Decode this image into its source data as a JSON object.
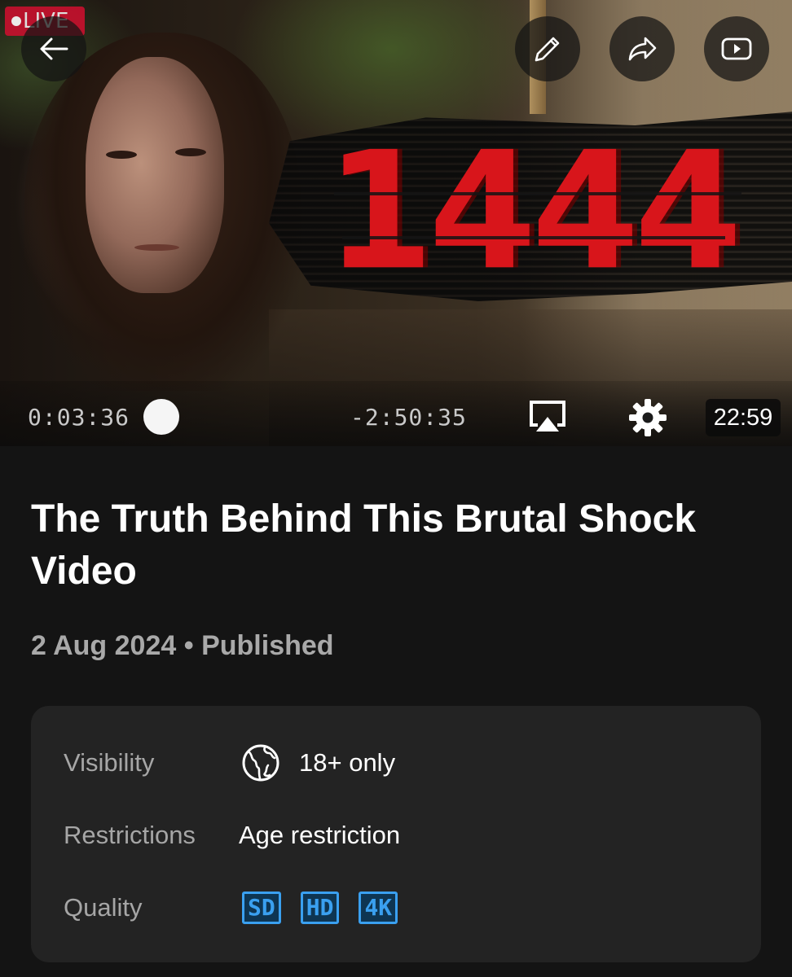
{
  "player": {
    "live_label": "LIVE",
    "thumbnail_text": "1444",
    "elapsed": "0:03:36",
    "remaining": "-2:50:35",
    "duration": "22:59"
  },
  "video": {
    "title": "The Truth Behind This Brutal Shock Video",
    "date": "2 Aug 2024",
    "separator": "•",
    "status": "Published"
  },
  "details": {
    "visibility_label": "Visibility",
    "visibility_value": "18+ only",
    "restrictions_label": "Restrictions",
    "restrictions_value": "Age restriction",
    "quality_label": "Quality",
    "quality_badges": [
      "SD",
      "HD",
      "4K"
    ]
  },
  "colors": {
    "background": "#141414",
    "card": "#232323",
    "accent_red": "#d8151b",
    "quality_blue": "#3aa0f0"
  },
  "icons": [
    "back-arrow-icon",
    "edit-pencil-icon",
    "share-icon",
    "youtube-icon",
    "airplay-icon",
    "settings-gear-icon",
    "globe-icon"
  ]
}
